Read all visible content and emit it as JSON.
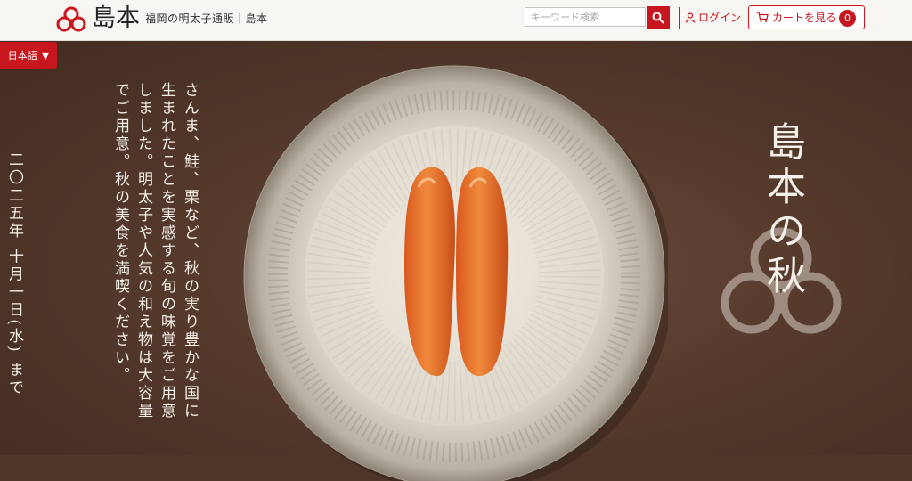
{
  "header": {
    "logo_text": "島本",
    "tagline": "福岡の明太子通販｜島本",
    "search_placeholder": "キーワード検索",
    "login_label": "ログイン",
    "cart_label": "カートを見る",
    "cart_count": "0"
  },
  "language": {
    "current": "日本語"
  },
  "hero": {
    "title": "島本の秋",
    "body": "さんま、鮭、栗など、秋の実り豊かな国に生まれたことを実感する旬の味覚をご用意しました。明太子や人気の和え物は大容量でご用意。秋の美食を満喫ください。",
    "date": "二〇二五年 十月一日(水) まで"
  },
  "colors": {
    "brand_red": "#c8161e",
    "background": "#4e3528"
  }
}
